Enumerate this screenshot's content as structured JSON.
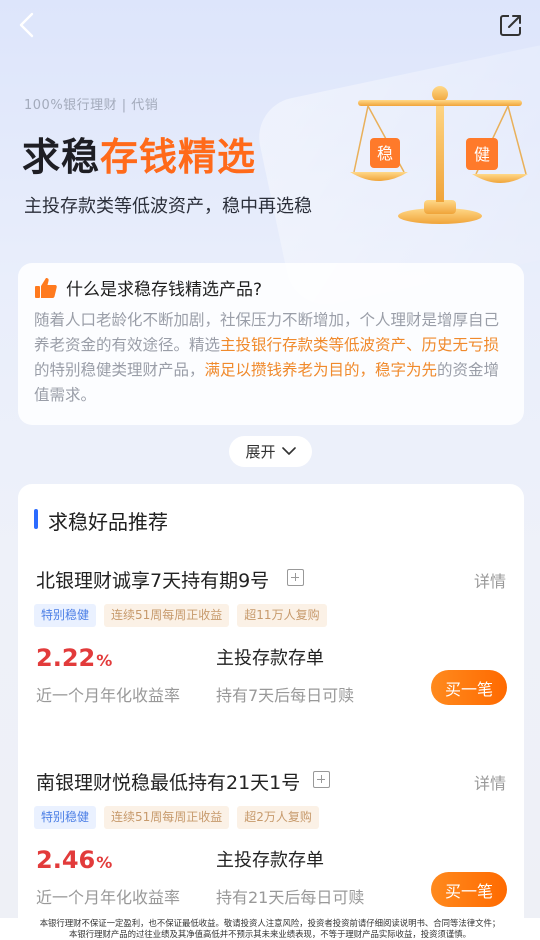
{
  "nav": {
    "back_icon": "chevron-left-icon",
    "share_icon": "share-external-icon"
  },
  "hero": {
    "sub_brand": "100%银行理财 | 代销",
    "title_part1": "求稳",
    "title_part2": "存钱精选",
    "subtitle": "主投存款类等低波资产，稳中再选稳",
    "scale_left_char": "稳",
    "scale_right_char": "健"
  },
  "info": {
    "title": "什么是求稳存钱精选产品?",
    "p1": "随着人口老龄化不断加剧，社保压力不断增加，个人理财是增厚自己养老资金的有效途径。精选",
    "hl1": "主投银行存款类等低波资产、历史无亏损",
    "p2": "的特别稳健类理财产品，",
    "hl2": "满足以攒钱养老为目的，稳字为先",
    "p3": "的资金增值需求。"
  },
  "expand": {
    "label": "展开"
  },
  "recommend": {
    "title": "求稳好品推荐",
    "products": [
      {
        "name": "北银理财诚享7天持有期9号",
        "detail": "详情",
        "tags": [
          "特别稳健",
          "连续51周每周正收益",
          "超11万人复购"
        ],
        "rate": "2.22",
        "rate_unit": "%",
        "rate_label": "近一个月年化收益率",
        "type": "主投存款存单",
        "redeem": "持有7天后每日可赎",
        "buy": "买一笔"
      },
      {
        "name": "南银理财悦稳最低持有21天1号",
        "detail": "详情",
        "tags": [
          "特别稳健",
          "连续51周每周正收益",
          "超2万人复购"
        ],
        "rate": "2.46",
        "rate_unit": "%",
        "rate_label": "近一个月年化收益率",
        "type": "主投存款存单",
        "redeem": "持有21天后每日可赎",
        "buy": "买一笔"
      }
    ]
  },
  "disclaimer": {
    "line1": "本银行理财不保证一定盈利，也不保证最低收益。敬请投资人注意风险，投资者投资前请仔细阅读说明书、合同等法律文件；",
    "line2": "本银行理财产品的过往业绩及其净值高低并不预示其未来业绩表现，不等于理财产品实际收益，投资须谨慎。"
  },
  "colors": {
    "accent_orange": "#ff6a1a",
    "rate_red": "#e23b3b",
    "title_bar_blue": "#2b6bff"
  }
}
